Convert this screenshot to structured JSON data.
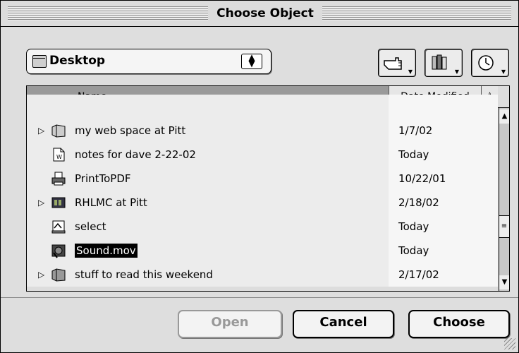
{
  "window": {
    "title": "Choose Object"
  },
  "location_popup": {
    "label": "Desktop"
  },
  "toolbar": {
    "shortcuts_icon": "hand-pointer-icon",
    "favorites_icon": "books-icon",
    "recent_icon": "clock-icon"
  },
  "list": {
    "columns": {
      "name": "Name",
      "date": "Date Modified"
    },
    "rows": [
      {
        "name": "my web space at Pitt",
        "date": "1/7/02",
        "expandable": true,
        "icon": "server-folder-icon"
      },
      {
        "name": "notes for dave 2-22-02",
        "date": "Today",
        "expandable": false,
        "icon": "document-icon"
      },
      {
        "name": "PrintToPDF",
        "date": "10/22/01",
        "expandable": false,
        "icon": "printer-icon"
      },
      {
        "name": "RHLMC at Pitt",
        "date": "2/18/02",
        "expandable": true,
        "icon": "server-volume-icon"
      },
      {
        "name": "select",
        "date": "Today",
        "expandable": false,
        "icon": "application-icon"
      },
      {
        "name": "Sound.mov",
        "date": "Today",
        "expandable": false,
        "icon": "movie-icon",
        "selected": true
      },
      {
        "name": "stuff to read this weekend",
        "date": "2/17/02",
        "expandable": true,
        "icon": "folder-icon"
      }
    ]
  },
  "buttons": {
    "open": "Open",
    "cancel": "Cancel",
    "choose": "Choose"
  }
}
